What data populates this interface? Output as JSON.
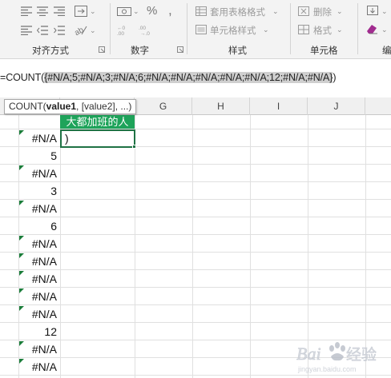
{
  "ribbon": {
    "groups": {
      "alignment_label": "对齐方式",
      "number_label": "数字",
      "styles_label": "样式",
      "cells_label": "单元格",
      "editing_label_partial": "编"
    },
    "styles": {
      "format_as_table": "套用表格格式",
      "cell_styles": "单元格样式"
    },
    "cells": {
      "delete": "删除",
      "format": "格式"
    }
  },
  "formula_bar": {
    "prefix": "=COUNT(",
    "selected": "{#N/A;5;#N/A;3;#N/A;6;#N/A;#N/A;#N/A;#N/A;#N/A;12;#N/A;#N/A}",
    "suffix": ")"
  },
  "tooltip": {
    "func": "COUNT(",
    "arg1": "value1",
    "rest": ", [value2], ...)"
  },
  "columns": [
    "G",
    "H",
    "I",
    "J"
  ],
  "header_cell": "大都加班的人",
  "active_cell": ")",
  "cells": [
    "#N/A",
    "5",
    "#N/A",
    "3",
    "#N/A",
    "6",
    "#N/A",
    "#N/A",
    "#N/A",
    "#N/A",
    "#N/A",
    "12",
    "#N/A",
    "#N/A"
  ],
  "watermark": "Baidu 经验"
}
